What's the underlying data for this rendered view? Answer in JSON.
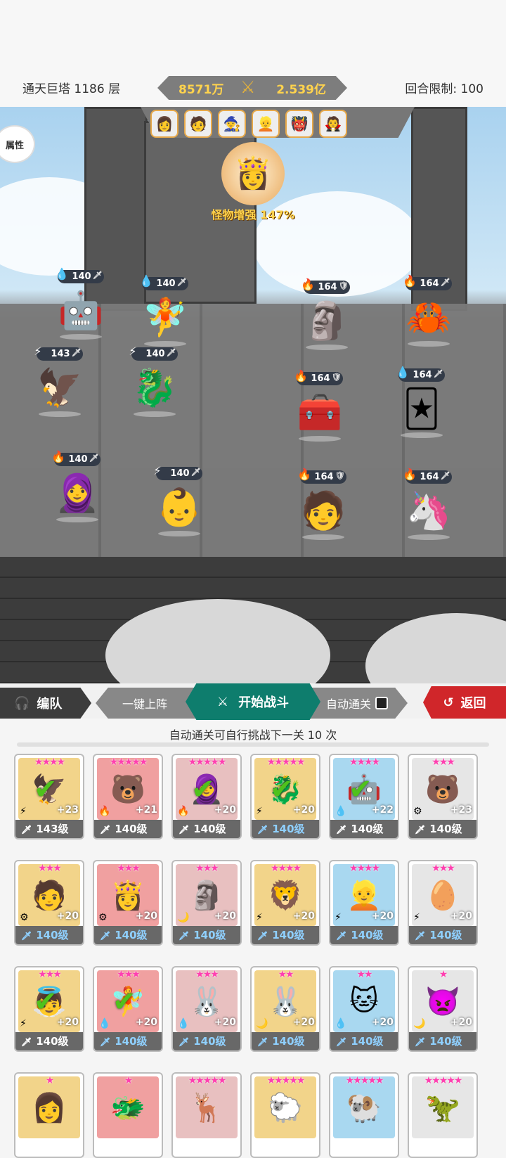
{
  "header": {
    "tower": "通天巨塔 1186 层",
    "my_power": "8571万",
    "enemy_power": "2.539亿",
    "round_limit": "回合限制: 100"
  },
  "battle": {
    "attr_button": "属性",
    "boss_buff": "怪物增强 147%",
    "portraits": [
      "👩",
      "🧑",
      "🧙",
      "👱",
      "👹",
      "🧛"
    ],
    "allies": [
      {
        "level": "140",
        "element": "💧",
        "unit": "🤖"
      },
      {
        "level": "140",
        "element": "💧",
        "unit": "🧚"
      },
      {
        "level": "143",
        "element": "⚡",
        "unit": "🦅"
      },
      {
        "level": "140",
        "element": "⚡",
        "unit": "🐉"
      },
      {
        "level": "140",
        "element": "🔥",
        "unit": "🧕"
      },
      {
        "level": "140",
        "element": "⚡",
        "unit": "👶"
      }
    ],
    "enemies": [
      {
        "level": "164",
        "element": "🔥",
        "unit": "🗿"
      },
      {
        "level": "164",
        "element": "🔥",
        "unit": "🦀"
      },
      {
        "level": "164",
        "element": "🔥",
        "unit": "🧰"
      },
      {
        "level": "164",
        "element": "💧",
        "unit": "🃏"
      },
      {
        "level": "164",
        "element": "🔥",
        "unit": "🧑"
      },
      {
        "level": "164",
        "element": "🔥",
        "unit": "🦄"
      }
    ]
  },
  "controls": {
    "team": "编队",
    "quick": "一键上阵",
    "start": "开始战斗",
    "auto": "自动通关",
    "back": "返回"
  },
  "note": "自动通关可自行挑战下一关 10 次",
  "cards": [
    {
      "stars": "★★★★",
      "plus": "+23",
      "level": "143级",
      "element": "⚡",
      "checked": true,
      "blue": false,
      "icon": "🦅"
    },
    {
      "stars": "★★★★★",
      "plus": "+21",
      "level": "140级",
      "element": "🔥",
      "checked": false,
      "blue": false,
      "icon": "🐻"
    },
    {
      "stars": "★★★★★",
      "plus": "+20",
      "level": "140级",
      "element": "🔥",
      "checked": true,
      "blue": false,
      "icon": "🧕"
    },
    {
      "stars": "★★★★★",
      "plus": "+20",
      "level": "140级",
      "element": "⚡",
      "checked": true,
      "blue": true,
      "icon": "🐉"
    },
    {
      "stars": "★★★★",
      "plus": "+22",
      "level": "140级",
      "element": "💧",
      "checked": true,
      "blue": false,
      "icon": "🤖"
    },
    {
      "stars": "★★★",
      "plus": "+23",
      "level": "140级",
      "element": "⚙",
      "checked": false,
      "blue": false,
      "icon": "🐻"
    },
    {
      "stars": "★★★",
      "plus": "+20",
      "level": "140级",
      "element": "⚙",
      "checked": false,
      "blue": true,
      "icon": "🧑"
    },
    {
      "stars": "★★★",
      "plus": "+20",
      "level": "140级",
      "element": "⚙",
      "checked": false,
      "blue": true,
      "icon": "👸"
    },
    {
      "stars": "★★★",
      "plus": "+20",
      "level": "140级",
      "element": "🌙",
      "checked": false,
      "blue": true,
      "icon": "🗿"
    },
    {
      "stars": "★★★★",
      "plus": "+20",
      "level": "140级",
      "element": "⚡",
      "checked": false,
      "blue": true,
      "icon": "🦁"
    },
    {
      "stars": "★★★★",
      "plus": "+20",
      "level": "140级",
      "element": "⚡",
      "checked": false,
      "blue": true,
      "icon": "👱"
    },
    {
      "stars": "★★★",
      "plus": "+20",
      "level": "140级",
      "element": "⚡",
      "checked": false,
      "blue": true,
      "icon": "🥚"
    },
    {
      "stars": "★★★",
      "plus": "+20",
      "level": "140级",
      "element": "⚡",
      "checked": true,
      "blue": false,
      "icon": "👼"
    },
    {
      "stars": "★★★",
      "plus": "+20",
      "level": "140级",
      "element": "💧",
      "checked": true,
      "blue": true,
      "icon": "🧚"
    },
    {
      "stars": "★★★",
      "plus": "+20",
      "level": "140级",
      "element": "💧",
      "checked": false,
      "blue": true,
      "icon": "🐰"
    },
    {
      "stars": "★★",
      "plus": "+20",
      "level": "140级",
      "element": "🌙",
      "checked": false,
      "blue": true,
      "icon": "🐰"
    },
    {
      "stars": "★★",
      "plus": "+20",
      "level": "140级",
      "element": "💧",
      "checked": false,
      "blue": true,
      "icon": "🐱"
    },
    {
      "stars": "★",
      "plus": "+20",
      "level": "140级",
      "element": "🌙",
      "checked": false,
      "blue": true,
      "icon": "👿"
    },
    {
      "stars": "★",
      "plus": "",
      "level": "",
      "element": "",
      "checked": false,
      "blue": false,
      "icon": "👩"
    },
    {
      "stars": "★",
      "plus": "",
      "level": "",
      "element": "",
      "checked": false,
      "blue": false,
      "icon": "🐲"
    },
    {
      "stars": "★★★★★",
      "plus": "",
      "level": "",
      "element": "",
      "checked": false,
      "blue": false,
      "icon": "🦌"
    },
    {
      "stars": "★★★★★",
      "plus": "",
      "level": "",
      "element": "",
      "checked": false,
      "blue": false,
      "icon": "🐑"
    },
    {
      "stars": "★★★★★",
      "plus": "",
      "level": "",
      "element": "",
      "checked": false,
      "blue": false,
      "icon": "🐏"
    },
    {
      "stars": "★★★★★",
      "plus": "",
      "level": "",
      "element": "",
      "checked": false,
      "blue": false,
      "icon": "🦖"
    }
  ]
}
